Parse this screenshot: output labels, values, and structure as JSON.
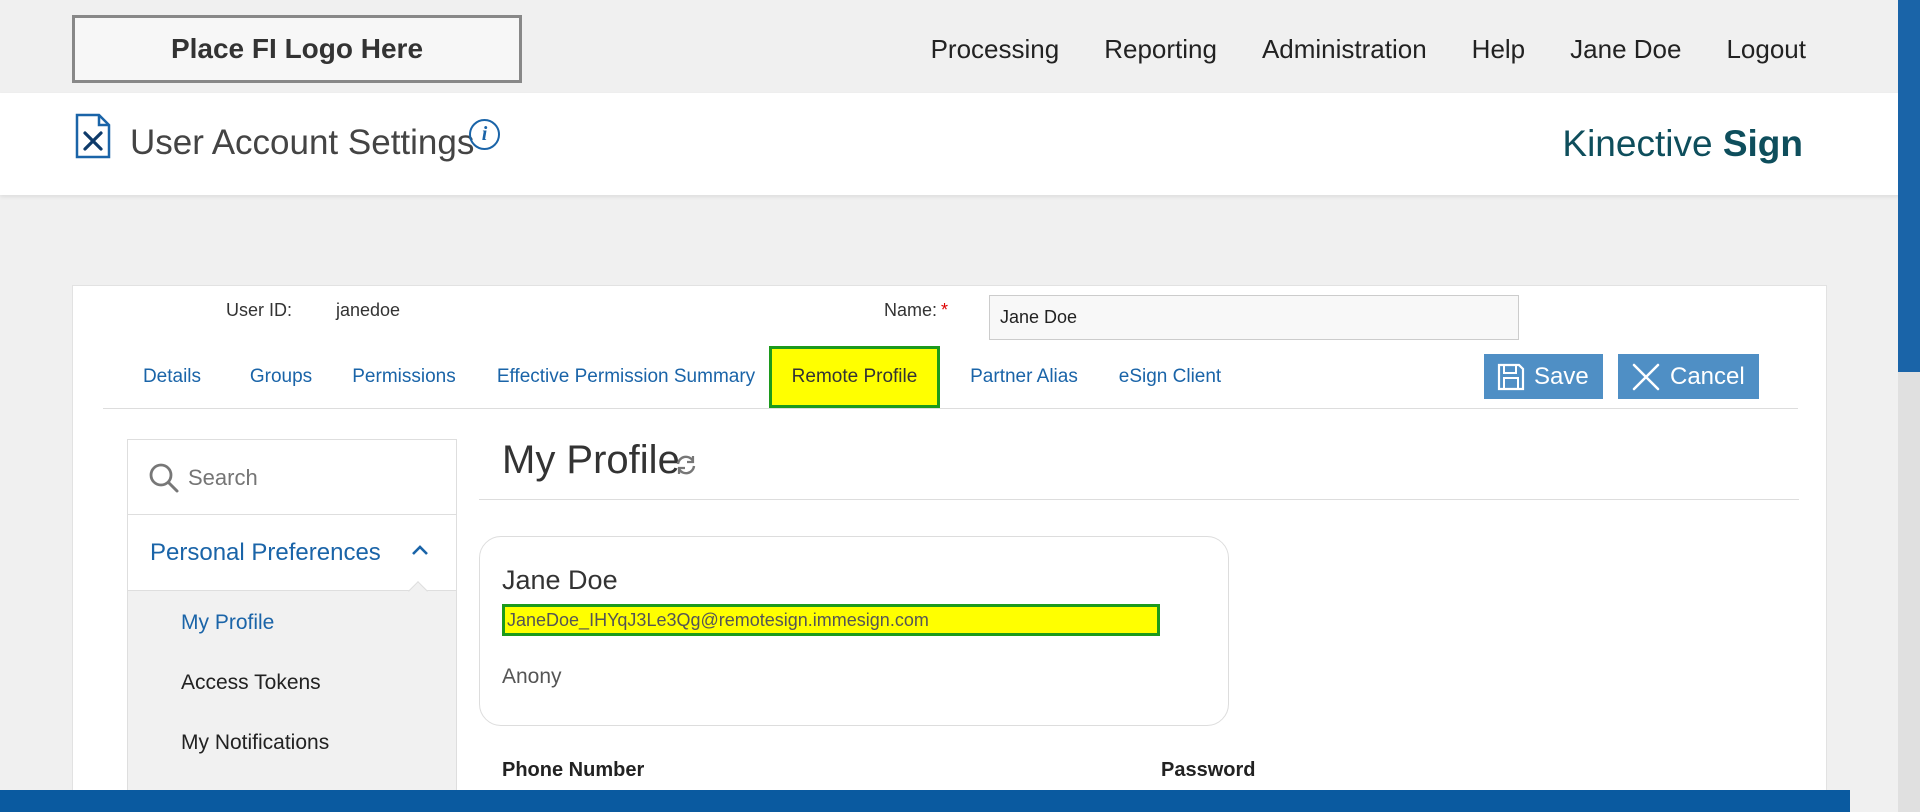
{
  "header": {
    "logo_text": "Place FI Logo Here",
    "nav": [
      "Processing",
      "Reporting",
      "Administration",
      "Help",
      "Jane Doe",
      "Logout"
    ]
  },
  "titlebar": {
    "title": "User Account Settings",
    "info_glyph": "i",
    "brand_light": "Kinective",
    "brand_bold": "Sign"
  },
  "user": {
    "id_label": "User ID:",
    "id_value": "janedoe",
    "name_label": "Name:",
    "required_mark": "*",
    "name_value": "Jane Doe"
  },
  "tabs": [
    "Details",
    "Groups",
    "Permissions",
    "Effective Permission Summary",
    "Remote Profile",
    "Partner Alias",
    "eSign Client"
  ],
  "active_tab": "Remote Profile",
  "actions": {
    "save_label": "Save",
    "cancel_label": "Cancel"
  },
  "sidebar": {
    "search_placeholder": "Search",
    "section": "Personal Preferences",
    "items": [
      "My Profile",
      "Access Tokens",
      "My Notifications"
    ],
    "current_item": "My Profile"
  },
  "profile": {
    "heading": "My Profile",
    "name": "Jane Doe",
    "email": "JaneDoe_IHYqJ3Le3Qg@remotesign.immesign.com",
    "subtitle": "Anony",
    "fields": [
      "Phone Number",
      "Password"
    ]
  },
  "colors": {
    "accent": "#1a64a8",
    "highlight": "#ffff00",
    "highlight_border": "#1c9a1c",
    "button": "#4f8fc5",
    "brand": "#0e4e5c"
  },
  "icons": [
    "document-wrench-icon",
    "info-icon",
    "save-disk-icon",
    "close-x-icon",
    "search-icon",
    "chevron-up-icon",
    "refresh-icon"
  ]
}
